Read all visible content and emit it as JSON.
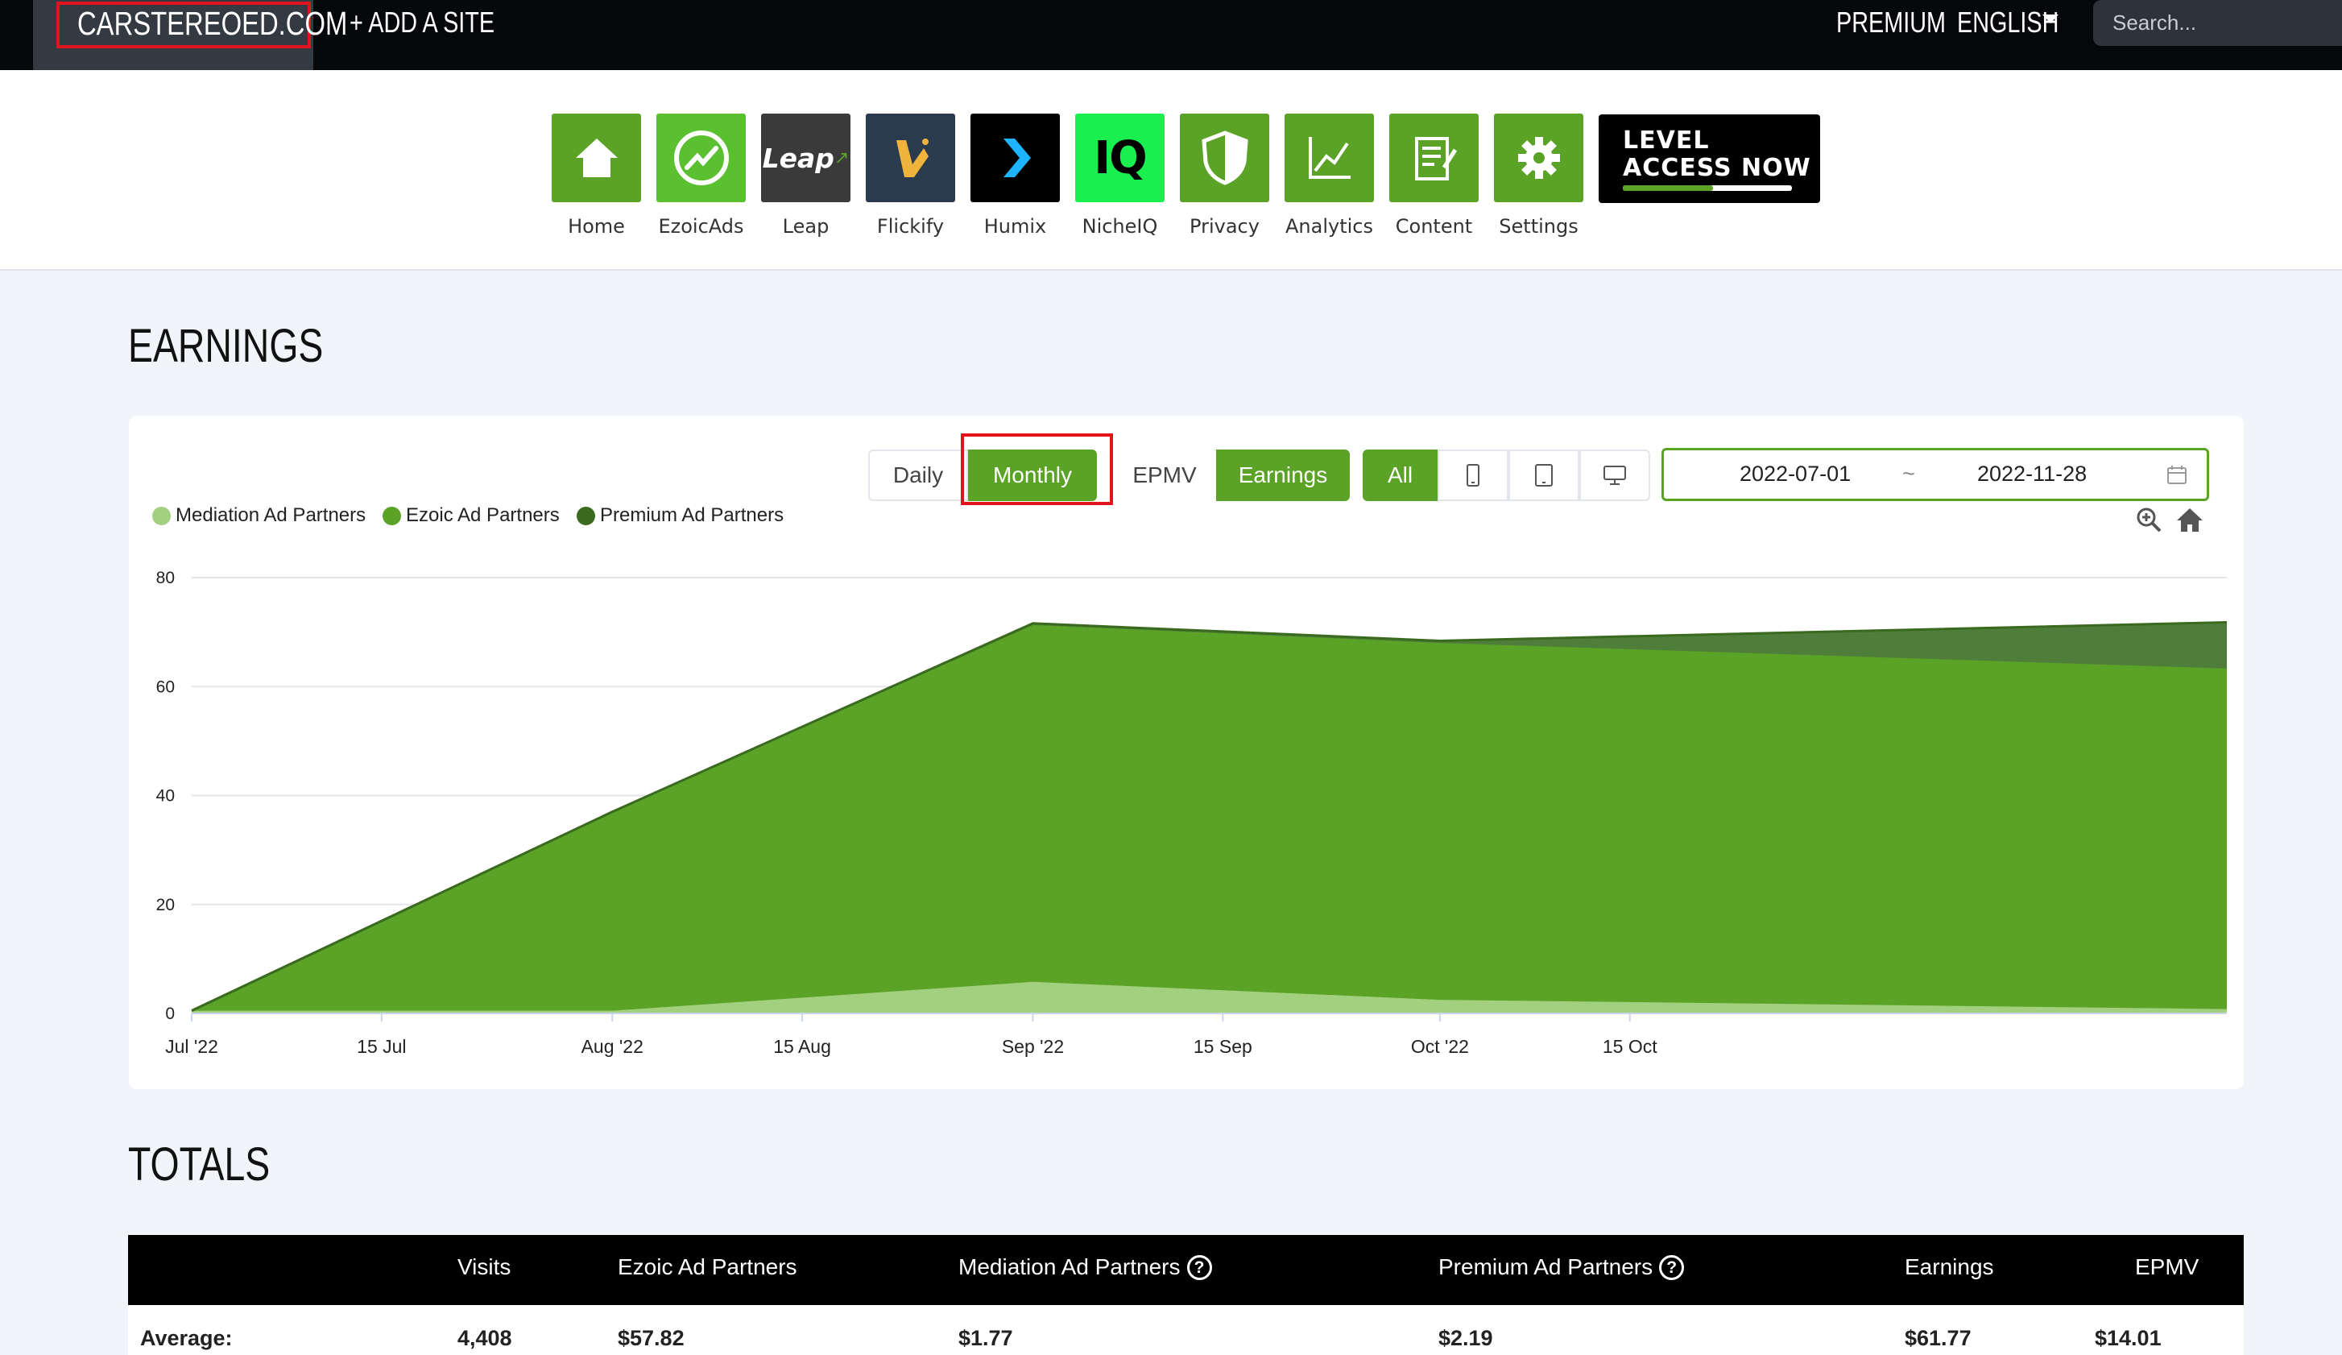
{
  "topnav": {
    "site_name": "CARSTEREOED.COM",
    "add_site": "+ ADD A SITE",
    "premium": "PREMIUM",
    "language": "ENGLISH",
    "search_placeholder": "Search..."
  },
  "apps": [
    {
      "label": "Home",
      "icon": "home-icon",
      "color": "#5aa326"
    },
    {
      "label": "EzoicAds",
      "icon": "ezoicads-icon",
      "color": "#5bc030"
    },
    {
      "label": "Leap",
      "icon": "leap-icon",
      "color": "#3a3a3a"
    },
    {
      "label": "Flickify",
      "icon": "flickify-icon",
      "color": "#2a3b4e"
    },
    {
      "label": "Humix",
      "icon": "humix-icon",
      "color": "#000000"
    },
    {
      "label": "NicheIQ",
      "icon": "nicheiq-icon",
      "color": "#19f04f"
    },
    {
      "label": "Privacy",
      "icon": "shield-icon",
      "color": "#5aa326"
    },
    {
      "label": "Analytics",
      "icon": "analytics-icon",
      "color": "#5aa326"
    },
    {
      "label": "Content",
      "icon": "content-icon",
      "color": "#5aa326"
    },
    {
      "label": "Settings",
      "icon": "gear-icon",
      "color": "#5aa326"
    }
  ],
  "promo": {
    "line1": "LEVEL",
    "line2": "ACCESS NOW"
  },
  "earnings": {
    "title": "EARNINGS",
    "period_buttons": [
      "Daily",
      "Monthly"
    ],
    "period_selected": "Monthly",
    "metric_buttons": [
      "EPMV",
      "Earnings"
    ],
    "metric_selected": "Earnings",
    "device_all": "All",
    "device_icons": [
      "mobile-icon",
      "tablet-icon",
      "desktop-icon"
    ],
    "date_start": "2022-07-01",
    "date_sep": "~",
    "date_end": "2022-11-28"
  },
  "chart_data": {
    "type": "area",
    "stacked": true,
    "ylim": [
      0,
      80
    ],
    "yticks": [
      "0",
      "20",
      "40",
      "60",
      "80"
    ],
    "xtick_labels": [
      "Jul '22",
      "15 Jul",
      "Aug '22",
      "15 Aug",
      "Sep '22",
      "15 Sep",
      "Oct '22",
      "15 Oct"
    ],
    "x": [
      "2022-07-01",
      "2022-08-01",
      "2022-09-01",
      "2022-10-01",
      "2022-11-28"
    ],
    "series": [
      {
        "name": "Mediation Ad Partners",
        "color": "#a3d07f",
        "values": [
          0.5,
          0.5,
          5.8,
          2.5,
          0.8
        ]
      },
      {
        "name": "Ezoic Ad Partners",
        "color": "#5aa326",
        "values": [
          0,
          36.5,
          65.5,
          65.5,
          62.5
        ]
      },
      {
        "name": "Premium Ad Partners",
        "color": "#3a6a1f",
        "values": [
          0,
          0,
          0.3,
          0.4,
          8.5
        ]
      }
    ],
    "legend": "top-left",
    "grid": true
  },
  "totals": {
    "title": "TOTALS",
    "headers": [
      "Visits",
      "Ezoic Ad Partners",
      "Mediation Ad Partners",
      "Premium Ad Partners",
      "Earnings",
      "EPMV"
    ],
    "row_label": "Average:",
    "row": [
      "4,408",
      "$57.82",
      "$1.77",
      "$2.19",
      "$61.77",
      "$14.01"
    ]
  }
}
